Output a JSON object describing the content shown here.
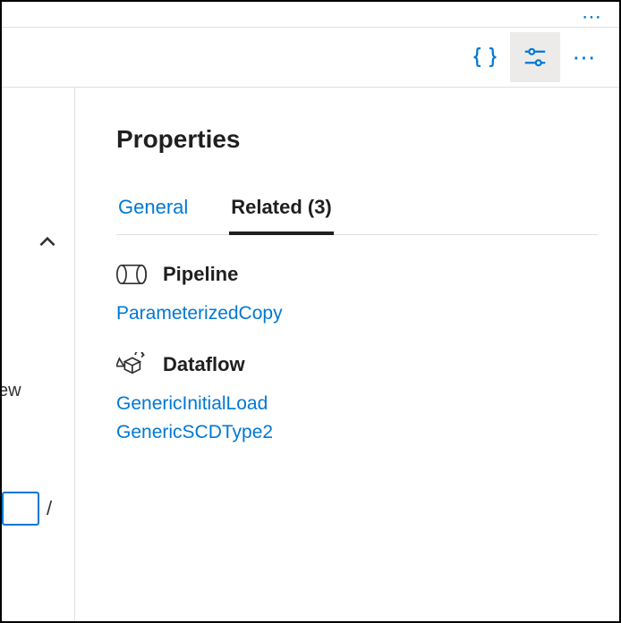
{
  "header": {
    "code_btn": "code-braces-icon",
    "settings_btn": "sliders-icon",
    "overflow": "⋯"
  },
  "left": {
    "fragment_text": "ew",
    "slash": "/"
  },
  "panel": {
    "title": "Properties",
    "tabs": {
      "general": "General",
      "related": "Related (3)"
    },
    "sections": {
      "pipeline": {
        "title": "Pipeline",
        "items": [
          "ParameterizedCopy"
        ]
      },
      "dataflow": {
        "title": "Dataflow",
        "items": [
          "GenericInitialLoad",
          "GenericSCDType2"
        ]
      }
    }
  },
  "top_overflow": "⋯"
}
